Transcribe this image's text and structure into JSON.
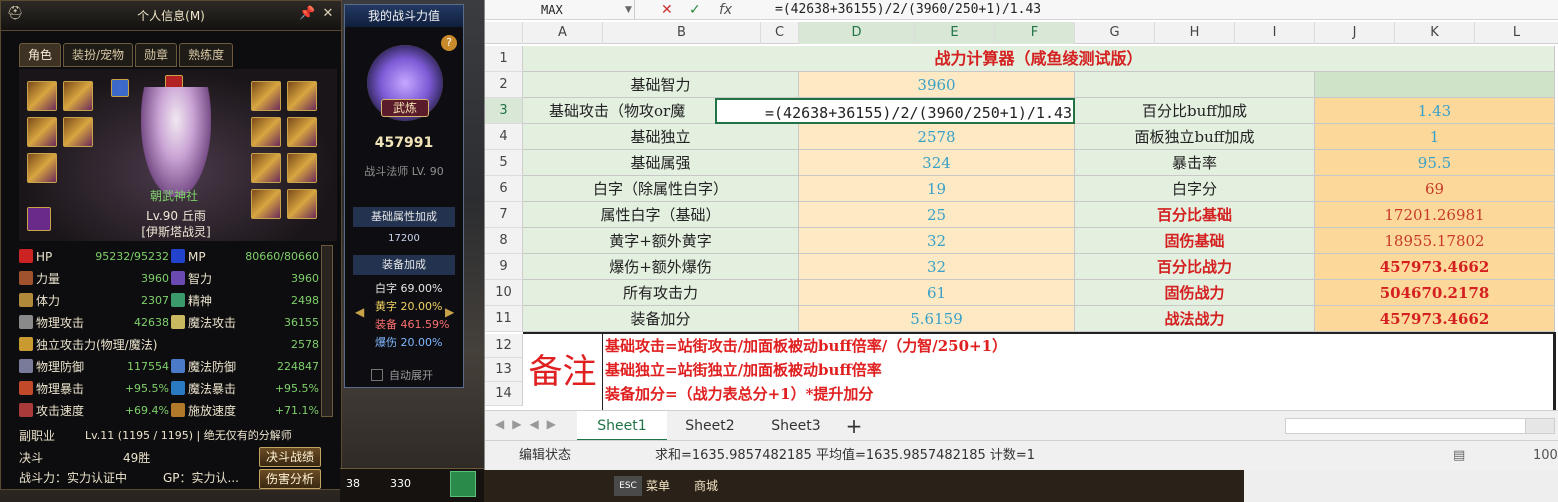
{
  "char_panel": {
    "title": "个人信息(M)",
    "tabs": [
      "角色",
      "装扮/宠物",
      "勋章",
      "熟练度"
    ],
    "guild": "朝武神社",
    "level_name": "Lv.90 丘雨",
    "tag": "[伊斯塔战灵]",
    "stats": [
      {
        "label": "HP",
        "value": "95232/95232",
        "label2": "MP",
        "value2": "80660/80660"
      },
      {
        "label": "力量",
        "value": "3960",
        "label2": "智力",
        "value2": "3960"
      },
      {
        "label": "体力",
        "value": "2307",
        "label2": "精神",
        "value2": "2498"
      },
      {
        "label": "物理攻击",
        "value": "42638",
        "label2": "魔法攻击",
        "value2": "36155"
      },
      {
        "label": "独立攻击力(物理/魔法)",
        "value": "2578",
        "label2": "",
        "value2": ""
      },
      {
        "label": "物理防御",
        "value": "117554",
        "label2": "魔法防御",
        "value2": "224847"
      },
      {
        "label": "物理暴击",
        "value": "+95.5%",
        "label2": "魔法暴击",
        "value2": "+95.5%"
      },
      {
        "label": "攻击速度",
        "value": "+69.4%",
        "label2": "施放速度",
        "value2": "+71.1%"
      }
    ],
    "subjob_label": "副职业",
    "subjob_value": "Lv.11 (1195 / 1195) | 绝无仅有的分解师",
    "duel_label": "决斗",
    "duel_value": "49胜",
    "duel_button": "决斗战绩",
    "power_label": "战斗力：实力认证中",
    "gp_label": "GP：实力认...",
    "damage_button": "伤害分析"
  },
  "power_panel": {
    "title": "我的战斗力值",
    "badge": "武炼",
    "value": "457991",
    "class": "战斗法师 LV. 90",
    "base_title": "基础属性加成",
    "base_value": "17200",
    "equip_title": "装备加成",
    "equip_rows": [
      {
        "label": "白字",
        "value": "69.00%",
        "color": "#e6e6e6"
      },
      {
        "label": "黄字",
        "value": "20.00%",
        "color": "#f0d060"
      },
      {
        "label": "装备",
        "value": "461.59%",
        "color": "#ff7070"
      },
      {
        "label": "爆伤",
        "value": "20.00%",
        "color": "#7fb8ff"
      }
    ],
    "auto_expand": "自动展开"
  },
  "spreadsheet": {
    "name_box": "MAX",
    "formula": "=(42638+36155)/2/(3960/250+1)/1.43",
    "columns": [
      "A",
      "B",
      "C",
      "D",
      "E",
      "F",
      "G",
      "H",
      "I",
      "J",
      "K",
      "L"
    ],
    "rows": [
      "1",
      "2",
      "3",
      "4",
      "5",
      "6",
      "7",
      "8",
      "9",
      "10",
      "11",
      "12",
      "13",
      "14"
    ],
    "title": "战力计算器（咸鱼绫测试版）",
    "left_labels": [
      "基础智力",
      "基础攻击（物攻or魔",
      "基础独立",
      "基础属强",
      "白字（除属性白字）",
      "属性白字（基础）",
      "黄字+额外黄字",
      "爆伤+额外爆伤",
      "所有攻击力",
      "装备加分"
    ],
    "left_values": [
      "3960",
      "=(42638+36155)/2/(3960/250+1)/1.43",
      "2578",
      "324",
      "19",
      "25",
      "32",
      "32",
      "61",
      "5.6159"
    ],
    "right_labels": [
      "",
      "百分比buff加成",
      "面板独立buff加成",
      "暴击率",
      "白字分",
      "百分比基础",
      "固伤基础",
      "百分比战力",
      "固伤战力",
      "战法战力"
    ],
    "right_values": [
      "",
      "1.43",
      "1",
      "95.5",
      "69",
      "17201.26981",
      "18955.17802",
      "457973.4662",
      "504670.2178",
      "457973.4662"
    ],
    "note_title": "备注",
    "notes": [
      "基础攻击=站街攻击/加面板被动buff倍率/（力智/250+1）",
      "基础独立=站街独立/加面板被动buff倍率",
      "装备加分=（战力表总分+1）*提升加分"
    ],
    "sheet_tabs": [
      "Sheet1",
      "Sheet2",
      "Sheet3"
    ],
    "add_sheet": "+",
    "status_mode": "编辑状态",
    "status_summary": "求和=1635.9857482185  平均值=1635.9857482185  计数=1",
    "zoom": "100"
  },
  "hotbar": {
    "esc": "ESC",
    "menu": "菜单",
    "shop": "商城",
    "gold": "330",
    "count": "38"
  },
  "colors": {
    "accent_green": "#217346",
    "red": "#d42020",
    "cell_green": "#e3efdf",
    "cell_orange": "#fcd99b"
  }
}
